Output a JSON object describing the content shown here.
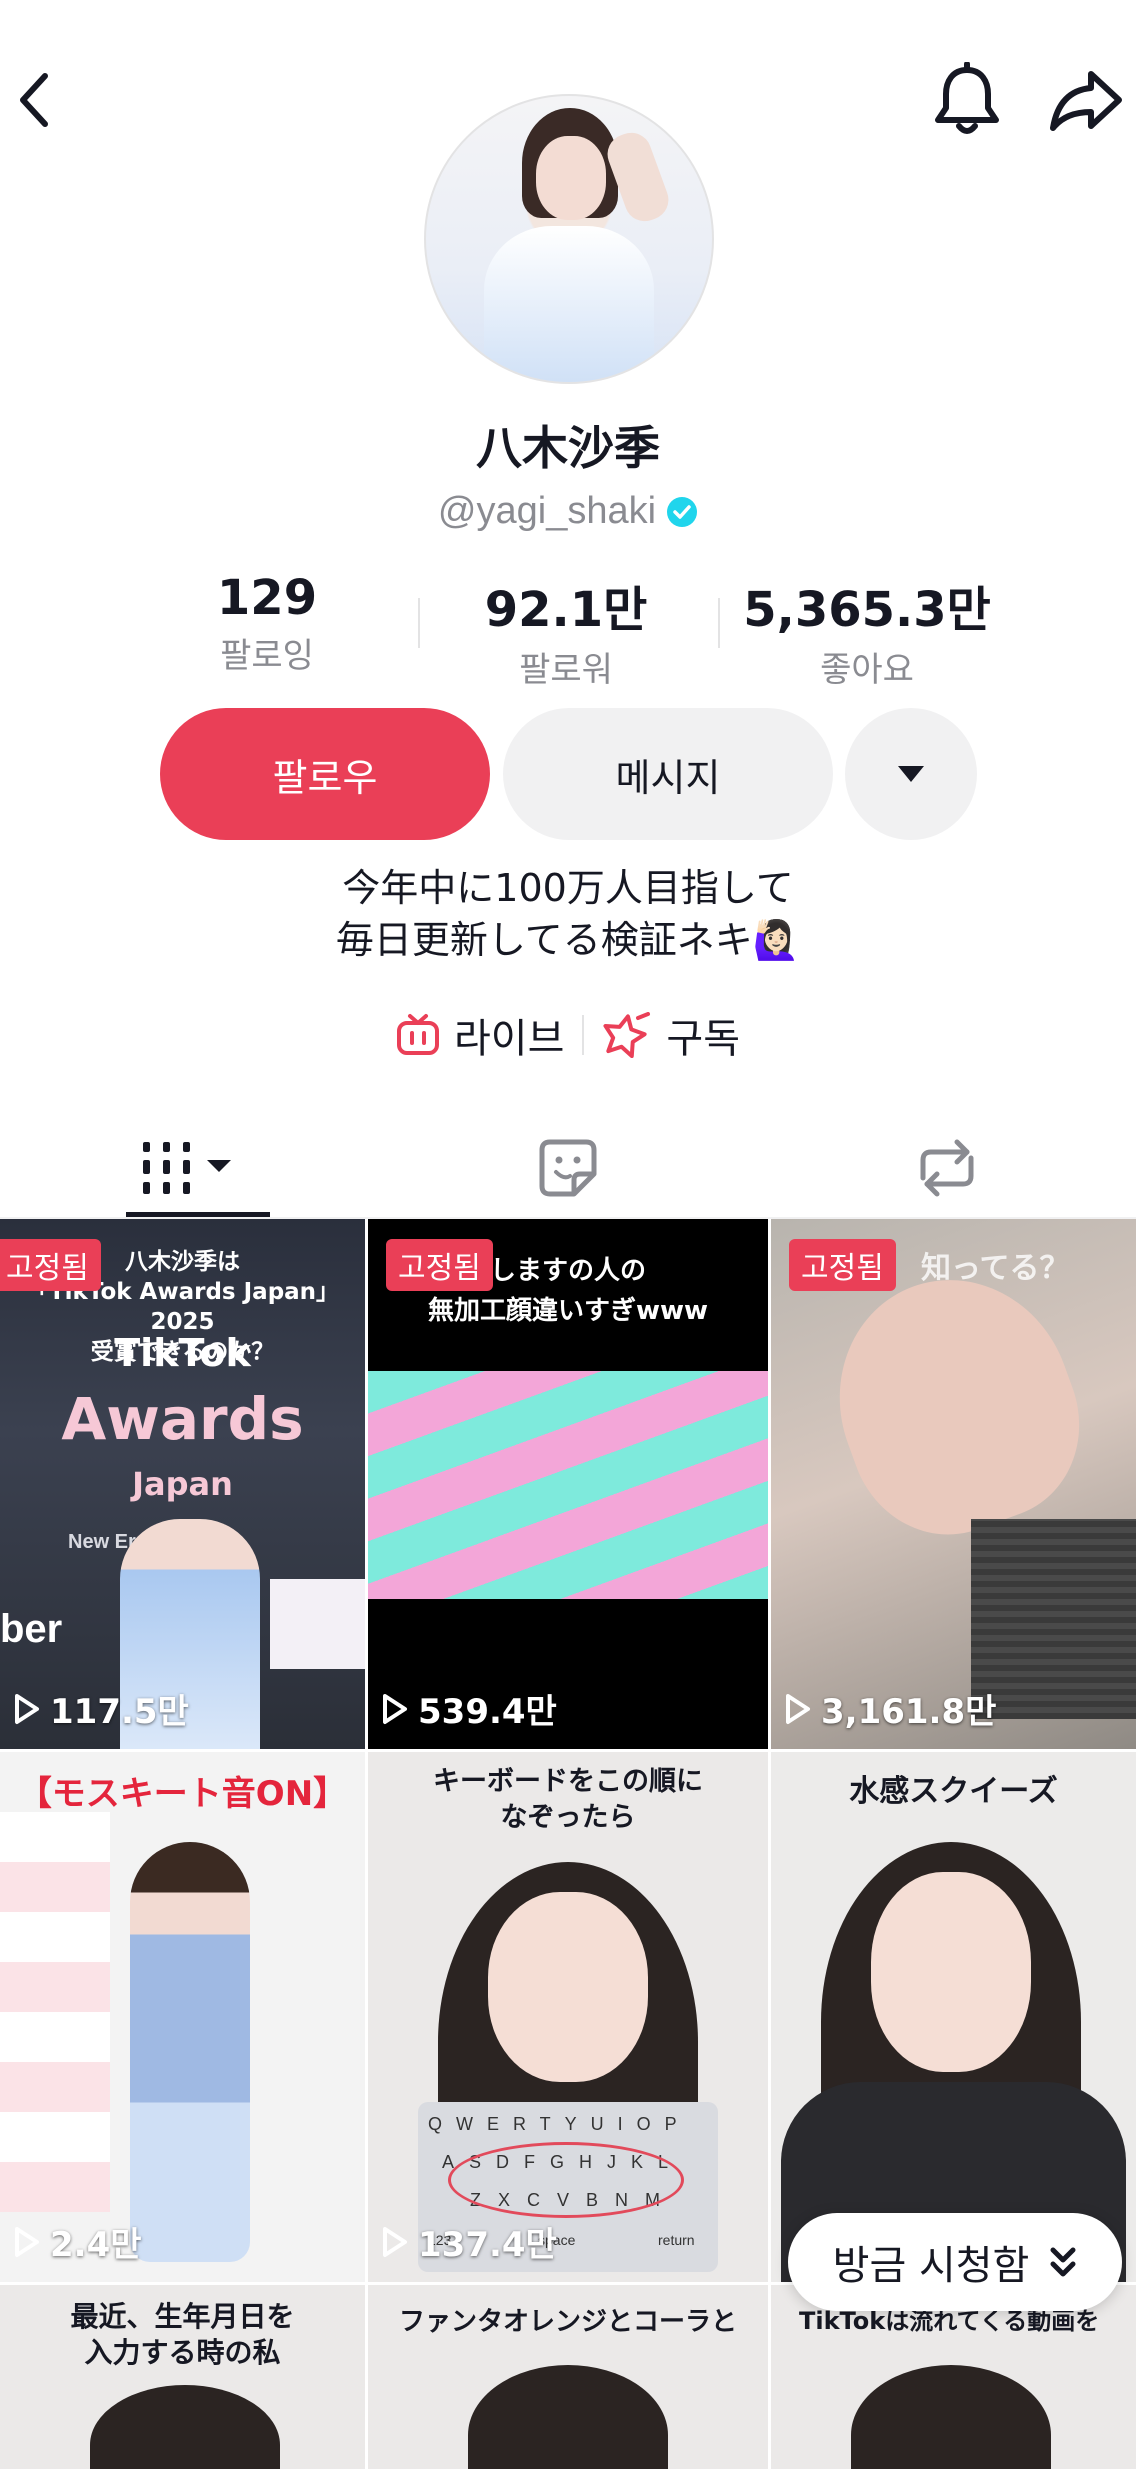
{
  "profile": {
    "name": "八木沙季",
    "handle": "@yagi_shaki",
    "bio_line1": "今年中に100万人目指して",
    "bio_line2": "毎日更新してる検証ネキ🙋🏻‍♀️"
  },
  "stats": {
    "following_count": "129",
    "following_label": "팔로잉",
    "followers_count": "92.1만",
    "followers_label": "팔로워",
    "likes_count": "5,365.3만",
    "likes_label": "좋아요"
  },
  "actions": {
    "follow_label": "팔로우",
    "message_label": "메시지"
  },
  "links": {
    "live_label": "라이브",
    "subscribe_label": "구독"
  },
  "colors": {
    "accent": "#ea3f57",
    "verified": "#20d5ec",
    "button_gray": "#f1f1f2",
    "secondary_text": "#8a8b91"
  },
  "videos": [
    {
      "pinned": "고정됨",
      "views": "117.5만",
      "caption_top": "八木沙季は\n「TikTok Awards Japan」2025\n受賞できるのか？",
      "overlay_brand": "TikTok",
      "overlay_title": "Awards",
      "overlay_sub": "Japan",
      "overlay_new": "New Er",
      "overlay_ber": "ber"
    },
    {
      "pinned": "고정됨",
      "views": "539.4만",
      "caption_top": "しますの人の\n無加工顔違いすぎwww"
    },
    {
      "pinned": "고정됨",
      "views": "3,161.8만",
      "caption_top": "知ってる？"
    },
    {
      "views": "2.4만",
      "caption_top": "【モスキート音ON】"
    },
    {
      "views": "137.4만",
      "caption_top": "キーボードをこの順に\nなぞったら",
      "kb_row1": "QWERTYUIOP",
      "kb_row2": "ASDFGHJKL",
      "kb_row3": "ZXCVBNM",
      "kb_space": "space",
      "kb_return": "return",
      "kb_num": "123"
    },
    {
      "views": "",
      "caption_top": "水感スクイーズ"
    },
    {
      "caption_top": "最近、生年月日を\n入力する時の私"
    },
    {
      "caption_top": "ファンタオレンジとコーラと"
    },
    {
      "caption_top": "TikTokは流れてくる動画を"
    }
  ],
  "watching_now": {
    "label": "방금 시청함"
  },
  "icons": {
    "back": "back-chevron-icon",
    "bell": "bell-icon",
    "share": "share-arrow-icon",
    "verified": "verified-badge-icon",
    "dropdown": "triangle-down-icon",
    "live": "tv-live-icon",
    "subscribe": "star-subscribe-icon",
    "videos_tab": "grid-bars-icon",
    "favorites_tab": "sticker-icon",
    "reposts_tab": "repost-icon",
    "play": "play-outline-icon",
    "double_chevron": "double-chevron-down-icon"
  }
}
